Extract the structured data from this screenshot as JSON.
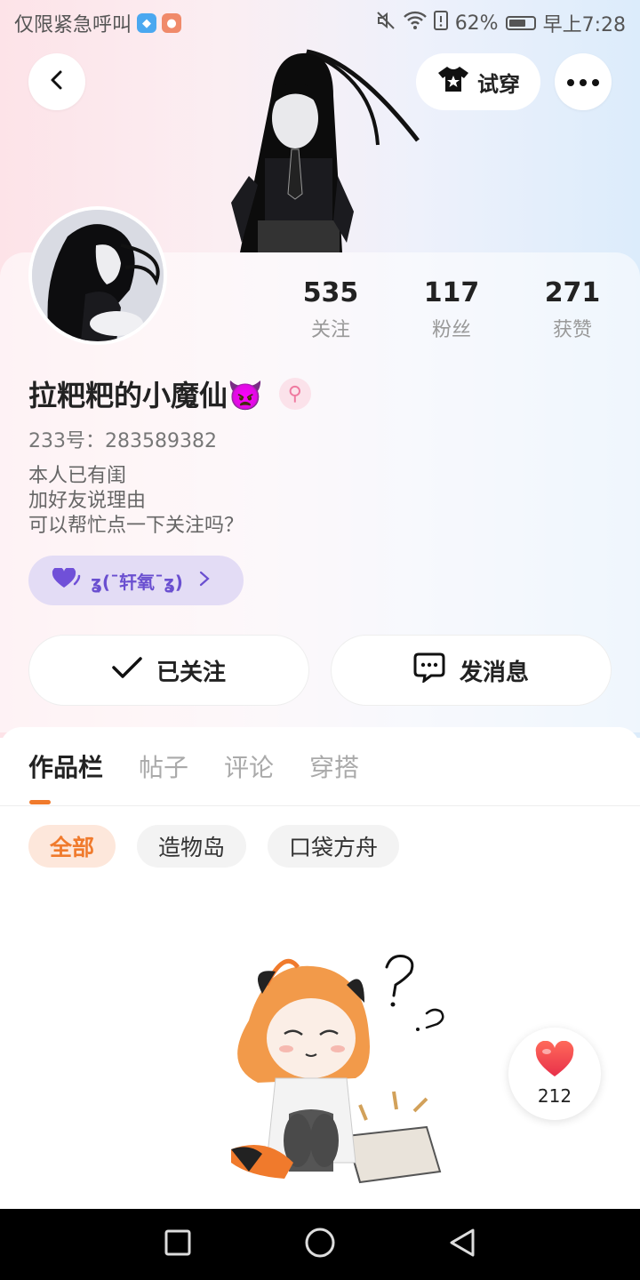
{
  "status_bar": {
    "left_text": "仅限紧急呼叫",
    "battery": "62%",
    "time": "早上7:28",
    "battery_level": 0.62
  },
  "header": {
    "tryon_label": "试穿"
  },
  "profile": {
    "stats": [
      {
        "value": "535",
        "label": "关注"
      },
      {
        "value": "117",
        "label": "粉丝"
      },
      {
        "value": "271",
        "label": "获赞"
      }
    ],
    "nickname": "拉粑粑的小魔仙",
    "nickname_emoji": "👿",
    "gender_symbol": "⚲",
    "uid": "233号：283589382",
    "bio": [
      "本人已有闺",
      "加好友说理由",
      "可以帮忙点一下关注吗？"
    ],
    "relation_tag": "ʓ(¯轩氧¯ʓ)",
    "follow_label": "已关注",
    "message_label": "发消息"
  },
  "tabs": [
    {
      "label": "作品栏",
      "active": true
    },
    {
      "label": "帖子",
      "active": false
    },
    {
      "label": "评论",
      "active": false
    },
    {
      "label": "穿搭",
      "active": false
    }
  ],
  "filters": [
    {
      "label": "全部",
      "active": true
    },
    {
      "label": "造物岛",
      "active": false
    },
    {
      "label": "口袋方舟",
      "active": false
    }
  ],
  "like_float": {
    "count": "212"
  },
  "colors": {
    "accent": "#f07a2c",
    "relation_purple": "#6a4fd0",
    "heart": "#f04040"
  }
}
